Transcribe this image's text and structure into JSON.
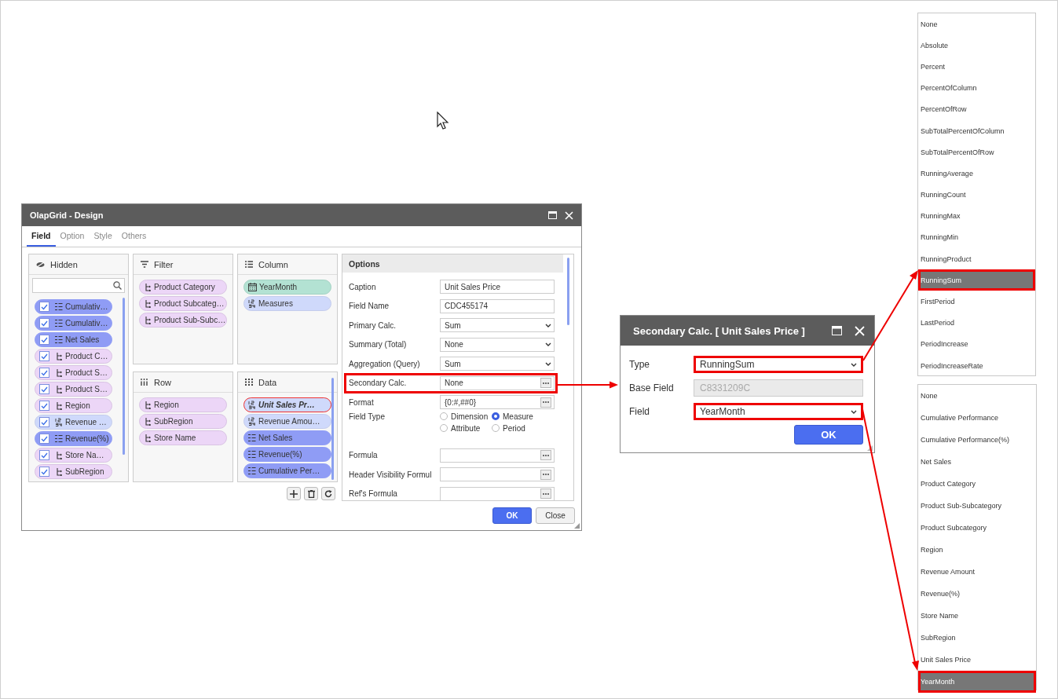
{
  "main_dialog": {
    "title": "OlapGrid - Design",
    "tabs": [
      {
        "label": "Field",
        "selected": true
      },
      {
        "label": "Option",
        "selected": false
      },
      {
        "label": "Style",
        "selected": false
      },
      {
        "label": "Others",
        "selected": false
      }
    ],
    "hidden": {
      "title": "Hidden",
      "items": [
        {
          "label": "Cumulativ…",
          "kind": "calc",
          "checked": true
        },
        {
          "label": "Cumulativ…",
          "kind": "calc",
          "checked": true
        },
        {
          "label": "Net Sales",
          "kind": "calc",
          "checked": true
        },
        {
          "label": "Product C…",
          "kind": "dimension",
          "checked": true
        },
        {
          "label": "Product S…",
          "kind": "dimension",
          "checked": true
        },
        {
          "label": "Product S…",
          "kind": "dimension",
          "checked": true
        },
        {
          "label": "Region",
          "kind": "dimension",
          "checked": true
        },
        {
          "label": "Revenue …",
          "kind": "measure",
          "checked": true
        },
        {
          "label": "Revenue(%)",
          "kind": "calc",
          "checked": true
        },
        {
          "label": "Store Na…",
          "kind": "dimension",
          "checked": true
        },
        {
          "label": "SubRegion",
          "kind": "dimension",
          "checked": true
        }
      ]
    },
    "panels": [
      {
        "kind": "filter",
        "title": "Filter",
        "items": [
          {
            "label": "Product Category",
            "kind": "dimension",
            "selected": false
          },
          {
            "label": "Product Subcateg…",
            "kind": "dimension",
            "selected": false
          },
          {
            "label": "Product Sub-Subc…",
            "kind": "dimension",
            "selected": false
          }
        ]
      },
      {
        "kind": "column",
        "title": "Column",
        "items": [
          {
            "label": "YearMonth",
            "kind": "date",
            "selected": false
          },
          {
            "label": "Measures",
            "kind": "measure",
            "selected": false
          }
        ]
      },
      {
        "kind": "row",
        "title": "Row",
        "items": [
          {
            "label": "Region",
            "kind": "dimension",
            "selected": false
          },
          {
            "label": "SubRegion",
            "kind": "dimension",
            "selected": false
          },
          {
            "label": "Store Name",
            "kind": "dimension",
            "selected": false
          }
        ]
      },
      {
        "kind": "data",
        "title": "Data",
        "items": [
          {
            "label": "Unit Sales Pr…",
            "kind": "measure",
            "selected": true
          },
          {
            "label": "Revenue Amou…",
            "kind": "measure",
            "selected": false
          },
          {
            "label": "Net Sales",
            "kind": "calc",
            "selected": false
          },
          {
            "label": "Revenue(%)",
            "kind": "calc",
            "selected": false
          },
          {
            "label": "Cumulative Per…",
            "kind": "calc",
            "selected": false
          }
        ]
      }
    ],
    "options": {
      "title": "Options",
      "rows": [
        {
          "label": "Caption",
          "kind": "text",
          "value": "Unit Sales Price",
          "highlighted": false
        },
        {
          "label": "Field Name",
          "kind": "text",
          "value": "CDC455174",
          "highlighted": false
        },
        {
          "label": "Primary Calc.",
          "kind": "select",
          "value": "Sum",
          "highlighted": false
        },
        {
          "label": "Summary (Total)",
          "kind": "select",
          "value": "None",
          "highlighted": false
        },
        {
          "label": "Aggregation (Query)",
          "kind": "select",
          "value": "Sum",
          "highlighted": false
        },
        {
          "label": "Secondary Calc.",
          "kind": "picker",
          "value": "None",
          "highlighted": true
        },
        {
          "label": "Format",
          "kind": "picker",
          "value": "{0:#,##0}",
          "highlighted": false
        },
        {
          "label": "Field Type",
          "kind": "radio",
          "highlighted": false,
          "options": [
            {
              "label": "Dimension",
              "selected": false
            },
            {
              "label": "Measure",
              "selected": true
            },
            {
              "label": "Attribute",
              "selected": false
            },
            {
              "label": "Period",
              "selected": false
            }
          ]
        },
        {
          "label": "Formula",
          "kind": "picker",
          "highlighted": false
        },
        {
          "label": "Header Visibility Formul",
          "kind": "picker",
          "highlighted": false
        },
        {
          "label": "Ref's Formula",
          "kind": "picker",
          "highlighted": false
        }
      ]
    },
    "buttons": [
      {
        "label": "OK",
        "kind": "primary"
      },
      {
        "label": "Close",
        "kind": "secondary"
      }
    ]
  },
  "secondary_dialog": {
    "title": "Secondary Calc. [ Unit Sales Price ]",
    "rows": [
      {
        "label": "Type",
        "kind": "select",
        "value": "RunningSum",
        "highlighted": true
      },
      {
        "label": "Base Field",
        "kind": "disabled",
        "value": "C8331209C",
        "highlighted": false
      },
      {
        "label": "Field",
        "kind": "select",
        "value": "YearMonth",
        "highlighted": true
      }
    ],
    "ok": "OK"
  },
  "type_list": [
    {
      "label": "None",
      "selected": false
    },
    {
      "label": "Absolute",
      "selected": false
    },
    {
      "label": "Percent",
      "selected": false
    },
    {
      "label": "PercentOfColumn",
      "selected": false
    },
    {
      "label": "PercentOfRow",
      "selected": false
    },
    {
      "label": "SubTotalPercentOfColumn",
      "selected": false
    },
    {
      "label": "SubTotalPercentOfRow",
      "selected": false
    },
    {
      "label": "RunningAverage",
      "selected": false
    },
    {
      "label": "RunningCount",
      "selected": false
    },
    {
      "label": "RunningMax",
      "selected": false
    },
    {
      "label": "RunningMin",
      "selected": false
    },
    {
      "label": "RunningProduct",
      "selected": false
    },
    {
      "label": "RunningSum",
      "selected": true
    },
    {
      "label": "FirstPeriod",
      "selected": false
    },
    {
      "label": "LastPeriod",
      "selected": false
    },
    {
      "label": "PeriodIncrease",
      "selected": false
    },
    {
      "label": "PeriodIncreaseRate",
      "selected": false
    }
  ],
  "field_list": [
    {
      "label": "None",
      "selected": false
    },
    {
      "label": "Cumulative Performance",
      "selected": false
    },
    {
      "label": "Cumulative Performance(%)",
      "selected": false
    },
    {
      "label": "Net Sales",
      "selected": false
    },
    {
      "label": "Product Category",
      "selected": false
    },
    {
      "label": "Product Sub-Subcategory",
      "selected": false
    },
    {
      "label": "Product Subcategory",
      "selected": false
    },
    {
      "label": "Region",
      "selected": false
    },
    {
      "label": "Revenue Amount",
      "selected": false
    },
    {
      "label": "Revenue(%)",
      "selected": false
    },
    {
      "label": "Store Name",
      "selected": false
    },
    {
      "label": "SubRegion",
      "selected": false
    },
    {
      "label": "Unit Sales Price",
      "selected": false
    },
    {
      "label": "YearMonth",
      "selected": true
    }
  ]
}
